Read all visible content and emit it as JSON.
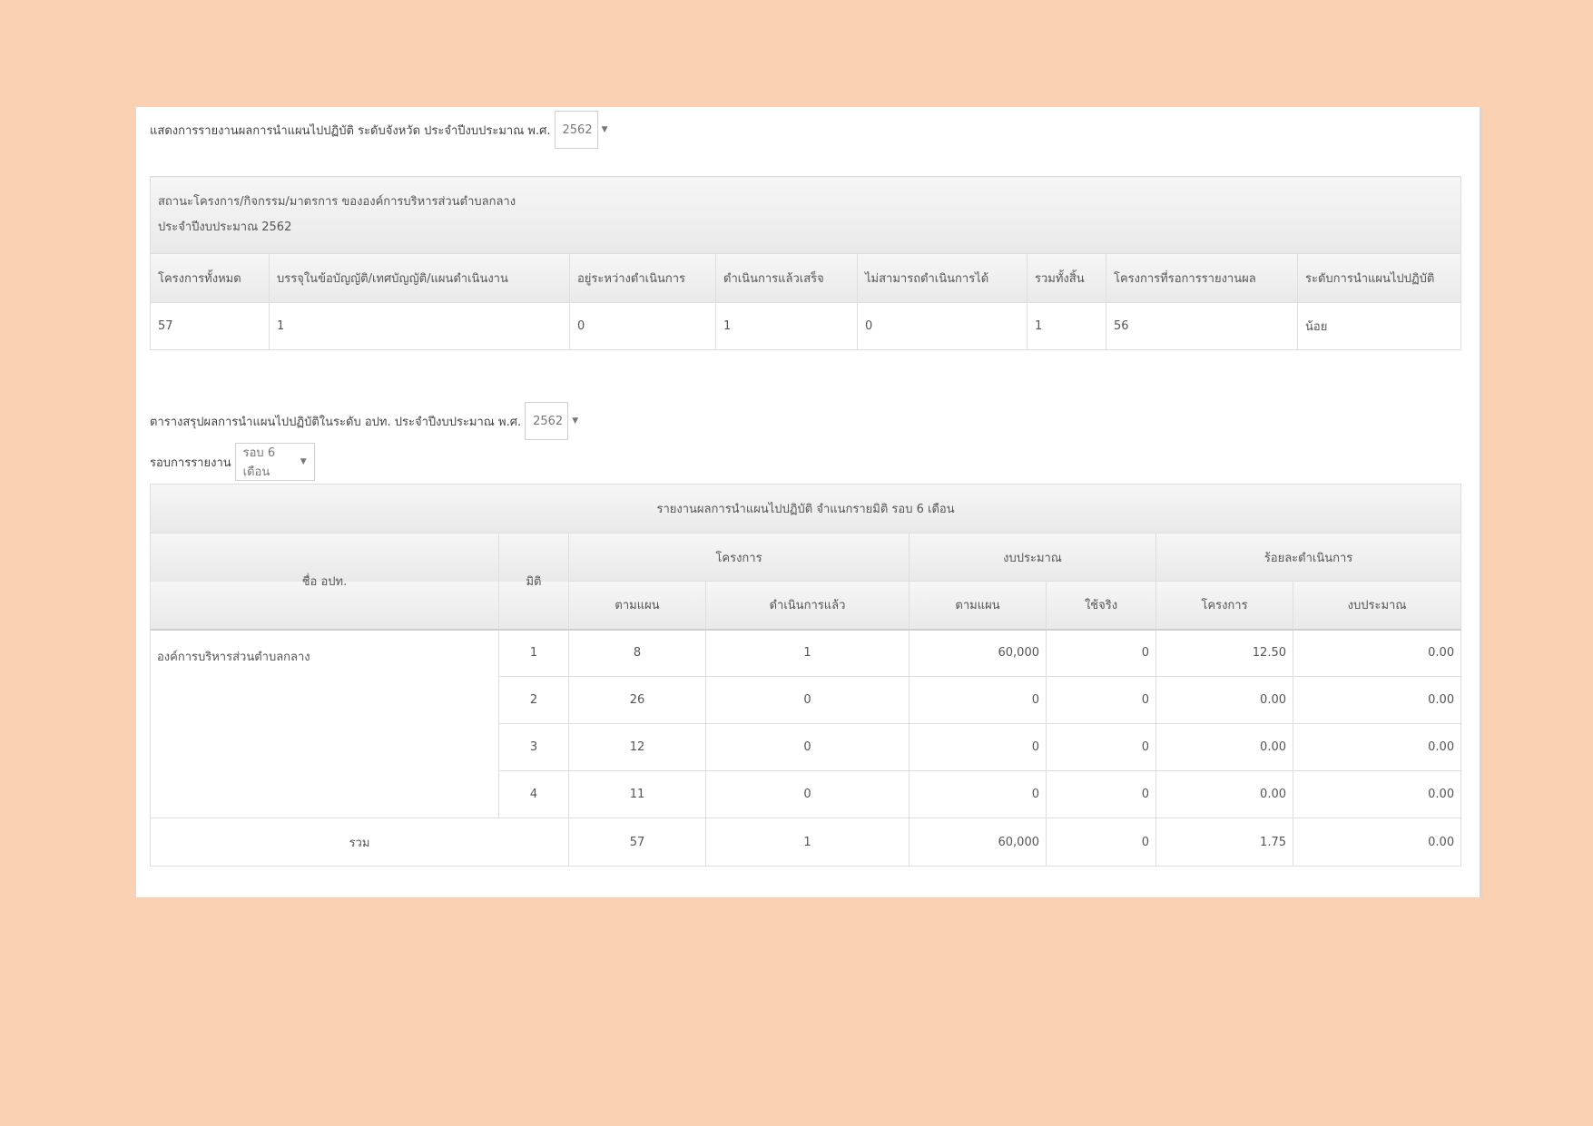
{
  "header": {
    "label": "แสดงการรายงานผลการนำแผนไปปฏิบัติ ระดับจังหวัด ประจำปีงบประมาณ พ.ศ.",
    "year": "2562"
  },
  "status_table": {
    "title_line1": "สถานะโครงการ/กิจกรรม/มาตรการ ขององค์การบริหารส่วนตำบลกลาง",
    "title_line2": "ประจำปีงบประมาณ 2562",
    "columns": [
      "โครงการทั้งหมด",
      "บรรจุในข้อบัญญัติ/เทศบัญญัติ/แผนดำเนินงาน",
      "อยู่ระหว่างดำเนินการ",
      "ดำเนินการแล้วเสร็จ",
      "ไม่สามารถดำเนินการได้",
      "รวมทั้งสิ้น",
      "โครงการที่รอการรายงานผล",
      "ระดับการนำแผนไปปฏิบัติ"
    ],
    "values": [
      "57",
      "1",
      "0",
      "1",
      "0",
      "1",
      "56",
      "น้อย"
    ]
  },
  "summary_filter": {
    "label": "ตารางสรุปผลการนำแผนไปปฏิบัติในระดับ อปท. ประจำปีงบประมาณ พ.ศ.",
    "year": "2562",
    "round_label": "รอบการรายงาน",
    "round_value": "รอบ 6 เดือน"
  },
  "summary_table": {
    "caption": "รายงานผลการนำแผนไปปฏิบัติ จำแนกรายมิติ รอบ 6 เดือน",
    "col_name": "ชื่อ อปท.",
    "col_dim": "มิติ",
    "group_project": "โครงการ",
    "group_budget": "งบประมาณ",
    "group_percent": "ร้อยละดำเนินการ",
    "sub_planned": "ตามแผน",
    "sub_done": "ดำเนินการแล้ว",
    "sub_budget_planned": "ตามแผน",
    "sub_budget_used": "ใช้จริง",
    "sub_pct_project": "โครงการ",
    "sub_pct_budget": "งบประมาณ",
    "org_name": "องค์การบริหารส่วนตำบลกลาง",
    "rows": [
      {
        "dim": "1",
        "planned": "8",
        "done": "1",
        "budget_plan": "60,000",
        "budget_used": "0",
        "pct_project": "12.50",
        "pct_budget": "0.00"
      },
      {
        "dim": "2",
        "planned": "26",
        "done": "0",
        "budget_plan": "0",
        "budget_used": "0",
        "pct_project": "0.00",
        "pct_budget": "0.00"
      },
      {
        "dim": "3",
        "planned": "12",
        "done": "0",
        "budget_plan": "0",
        "budget_used": "0",
        "pct_project": "0.00",
        "pct_budget": "0.00"
      },
      {
        "dim": "4",
        "planned": "11",
        "done": "0",
        "budget_plan": "0",
        "budget_used": "0",
        "pct_project": "0.00",
        "pct_budget": "0.00"
      }
    ],
    "total": {
      "label": "รวม",
      "planned": "57",
      "done": "1",
      "budget_plan": "60,000",
      "budget_used": "0",
      "pct_project": "1.75",
      "pct_budget": "0.00"
    }
  }
}
